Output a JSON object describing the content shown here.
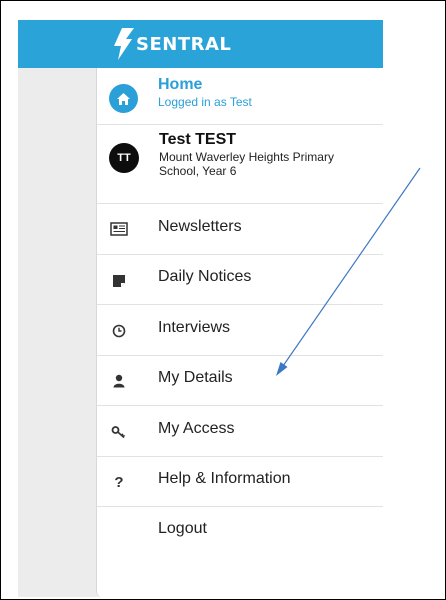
{
  "brand": {
    "name": "SENTRAL",
    "color": "#2aa3d9"
  },
  "home": {
    "title": "Home",
    "subtitle": "Logged in as Test"
  },
  "user": {
    "initials": "TT",
    "name": "Test TEST",
    "school": "Mount Waverley Heights Primary School, Year 6"
  },
  "menu": {
    "items": [
      {
        "label": "Newsletters",
        "icon": "newspaper-icon"
      },
      {
        "label": "Daily Notices",
        "icon": "note-icon"
      },
      {
        "label": "Interviews",
        "icon": "clock-icon"
      },
      {
        "label": "My Details",
        "icon": "user-icon"
      },
      {
        "label": "My Access",
        "icon": "key-icon"
      },
      {
        "label": "Help & Information",
        "icon": "question-icon"
      },
      {
        "label": "Logout",
        "icon": ""
      }
    ]
  },
  "annotation": {
    "type": "arrow",
    "color": "#3d78c5",
    "points_to": "Interviews"
  }
}
